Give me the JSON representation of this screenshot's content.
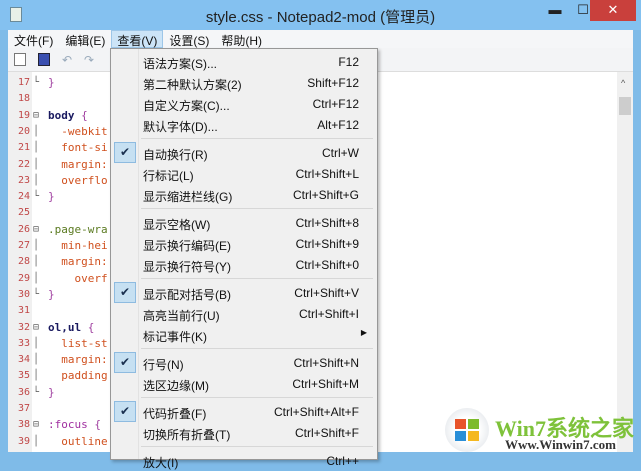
{
  "window": {
    "title": "style.css - Notepad2-mod (管理员)",
    "min": "▬",
    "max": "☐",
    "close": "✕"
  },
  "menubar": [
    "文件(F)",
    "编辑(E)",
    "查看(V)",
    "设置(S)",
    "帮助(H)"
  ],
  "code": [
    {
      "n": "17",
      "fold": "└",
      "parts": [
        [
          "br",
          "}"
        ]
      ]
    },
    {
      "n": "18",
      "fold": "",
      "parts": []
    },
    {
      "n": "19",
      "fold": "⊟",
      "parts": [
        [
          "sel",
          "body"
        ],
        [
          "br",
          " {"
        ]
      ]
    },
    {
      "n": "20",
      "fold": "│",
      "parts": [
        [
          "prop",
          "  -webkit"
        ]
      ]
    },
    {
      "n": "21",
      "fold": "│",
      "parts": [
        [
          "prop",
          "  font-si"
        ]
      ]
    },
    {
      "n": "22",
      "fold": "│",
      "parts": [
        [
          "prop",
          "  margin:"
        ]
      ]
    },
    {
      "n": "23",
      "fold": "│",
      "parts": [
        [
          "prop",
          "  overflo"
        ]
      ]
    },
    {
      "n": "24",
      "fold": "└",
      "parts": [
        [
          "br",
          "}"
        ]
      ]
    },
    {
      "n": "25",
      "fold": "",
      "parts": []
    },
    {
      "n": "26",
      "fold": "⊟",
      "parts": [
        [
          "cls",
          ".page-wra"
        ]
      ]
    },
    {
      "n": "27",
      "fold": "│",
      "parts": [
        [
          "prop",
          "  min-hei"
        ]
      ]
    },
    {
      "n": "28",
      "fold": "│",
      "parts": [
        [
          "prop",
          "  margin:"
        ]
      ]
    },
    {
      "n": "29",
      "fold": "│",
      "parts": [
        [
          "prop",
          "    overf"
        ]
      ]
    },
    {
      "n": "30",
      "fold": "└",
      "parts": [
        [
          "br",
          "}"
        ]
      ]
    },
    {
      "n": "31",
      "fold": "",
      "parts": []
    },
    {
      "n": "32",
      "fold": "⊟",
      "parts": [
        [
          "sel",
          "ol,ul"
        ],
        [
          "br",
          " {"
        ]
      ]
    },
    {
      "n": "33",
      "fold": "│",
      "parts": [
        [
          "prop",
          "  list-st"
        ]
      ]
    },
    {
      "n": "34",
      "fold": "│",
      "parts": [
        [
          "prop",
          "  margin:"
        ]
      ]
    },
    {
      "n": "35",
      "fold": "│",
      "parts": [
        [
          "prop",
          "  padding"
        ]
      ]
    },
    {
      "n": "36",
      "fold": "└",
      "parts": [
        [
          "br",
          "}"
        ]
      ]
    },
    {
      "n": "37",
      "fold": "",
      "parts": []
    },
    {
      "n": "38",
      "fold": "⊟",
      "parts": [
        [
          "ps",
          ":focus"
        ],
        [
          "br",
          " {"
        ]
      ]
    },
    {
      "n": "39",
      "fold": "│",
      "parts": [
        [
          "prop",
          "  outline"
        ]
      ]
    }
  ],
  "view_menu": [
    [
      {
        "label": "语法方案(S)...",
        "shortcut": "F12"
      },
      {
        "label": "第二种默认方案(2)",
        "shortcut": "Shift+F12"
      },
      {
        "label": "自定义方案(C)...",
        "shortcut": "Ctrl+F12"
      },
      {
        "label": "默认字体(D)...",
        "shortcut": "Alt+F12"
      }
    ],
    [
      {
        "label": "自动换行(R)",
        "shortcut": "Ctrl+W",
        "checked": true
      },
      {
        "label": "行标记(L)",
        "shortcut": "Ctrl+Shift+L"
      },
      {
        "label": "显示缩进栏线(G)",
        "shortcut": "Ctrl+Shift+G"
      }
    ],
    [
      {
        "label": "显示空格(W)",
        "shortcut": "Ctrl+Shift+8"
      },
      {
        "label": "显示换行编码(E)",
        "shortcut": "Ctrl+Shift+9"
      },
      {
        "label": "显示换行符号(Y)",
        "shortcut": "Ctrl+Shift+0"
      }
    ],
    [
      {
        "label": "显示配对括号(B)",
        "shortcut": "Ctrl+Shift+V",
        "checked": true
      },
      {
        "label": "高亮当前行(U)",
        "shortcut": "Ctrl+Shift+I"
      },
      {
        "label": "标记事件(K)",
        "shortcut": "",
        "submenu": true
      }
    ],
    [
      {
        "label": "行号(N)",
        "shortcut": "Ctrl+Shift+N",
        "checked": true
      },
      {
        "label": "选区边缘(M)",
        "shortcut": "Ctrl+Shift+M"
      }
    ],
    [
      {
        "label": "代码折叠(F)",
        "shortcut": "Ctrl+Shift+Alt+F",
        "checked": true
      },
      {
        "label": "切换所有折叠(T)",
        "shortcut": "Ctrl+Shift+F"
      }
    ],
    [
      {
        "label": "放大(I)",
        "shortcut": "Ctrl++"
      }
    ]
  ],
  "watermark": {
    "title": "Win7系统之家",
    "url": "Www.Winwin7.com"
  },
  "check_glyph": "✔",
  "submenu_glyph": "▶"
}
